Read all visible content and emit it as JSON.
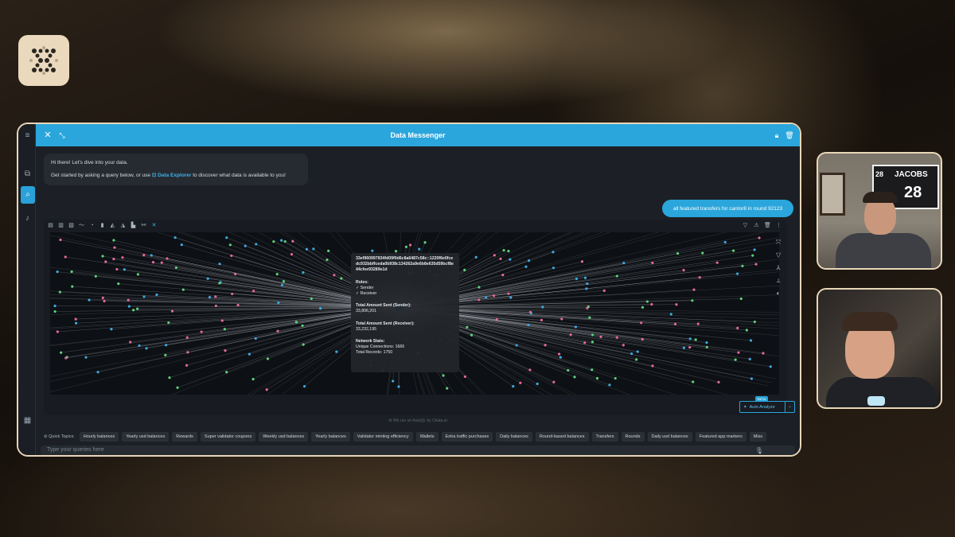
{
  "messenger": {
    "title": "Data Messenger",
    "welcome_line1": "Hi there! Let's dive into your data.",
    "welcome_line2_pre": "Get started by asking a query below, or use",
    "welcome_link": "Data Explorer",
    "welcome_line2_post": "to discover what data is available to you!",
    "user_query": "all featured transfers for cantor8 in round 92123",
    "powered_by": "We run on AutoQL by Chata.ai",
    "input_placeholder": "Type your queries here"
  },
  "tooltip": {
    "address": "33ef960997834fd09f0d6c8a6487c58c::1220f6e0fcedc932bbffceda0b938c134262a9e6b8e635d59bcf8e44cfee93289e1d",
    "roles_label": "Roles:",
    "role_sender": "✓ Sender",
    "role_receiver": "✓ Receiver",
    "sent_label": "Total Amount Sent (Sender):",
    "sent_value": "33,806,201",
    "recv_label": "Total Amount Sent (Receiver):",
    "recv_value": "33,232,195",
    "stats_label": "Network Stats:",
    "unique_connections": "Unique Connections: 1666",
    "total_records": "Total Records: 1750"
  },
  "auto_analyze": {
    "label": "Auto Analyze",
    "badge": "BETA"
  },
  "quick_topics": {
    "label": "Quick Topics:",
    "items": [
      "Hourly balances",
      "Yearly usd balances",
      "Rewards",
      "Super validator coupons",
      "Weekly usd balances",
      "Yearly balances",
      "Validator minting efficiency",
      "Wallets",
      "Extra traffic purchases",
      "Daily balances",
      "Round-based balances",
      "Transfers",
      "Rounds",
      "Daily usd balances",
      "Featured app markers",
      "Miss"
    ]
  },
  "colors": {
    "accent": "#2aa6dc",
    "node_center": "#2aa6dc",
    "node_pink": "#e46a9a",
    "node_green": "#5fd07a",
    "node_blue": "#3fa8e0"
  },
  "video": {
    "cam1_jersey_name": "JACOBS",
    "cam1_jersey_number": "28",
    "cam1_jersey_number_left": "28"
  }
}
